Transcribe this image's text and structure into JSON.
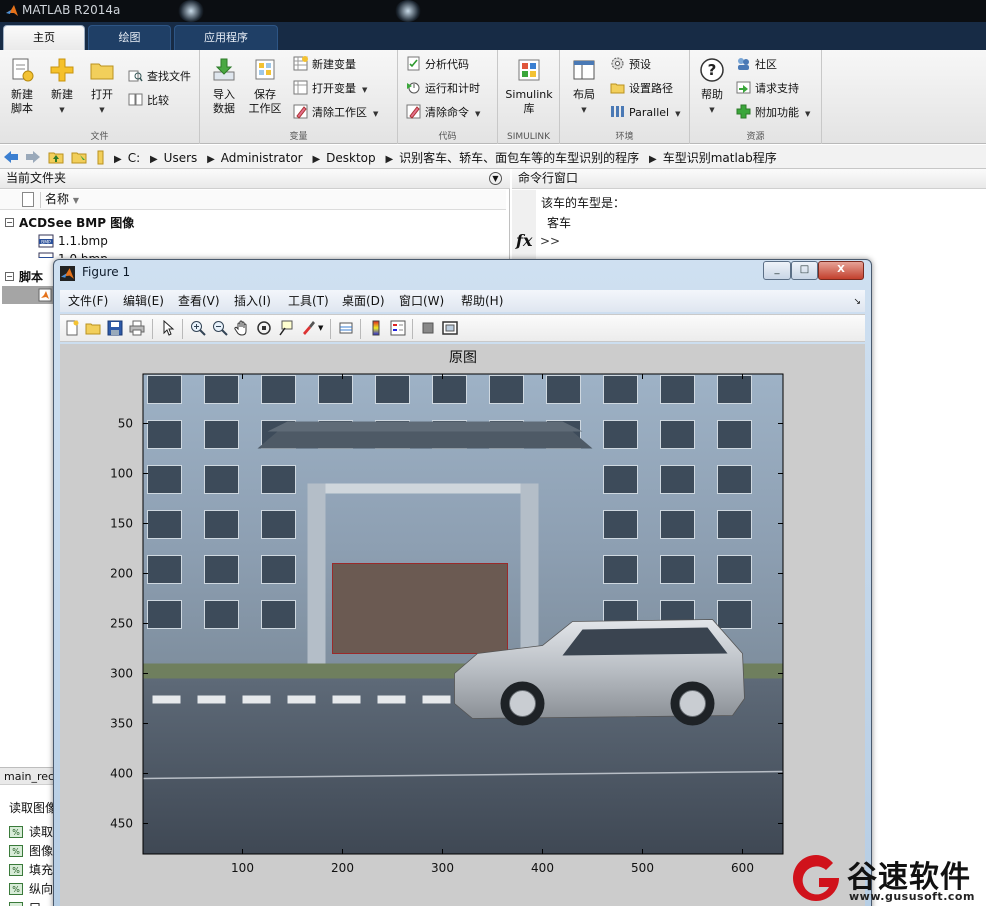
{
  "app": {
    "title": "MATLAB R2014a"
  },
  "ribbon": {
    "tabs": [
      {
        "label": "主页",
        "active": true
      },
      {
        "label": "绘图",
        "active": false
      },
      {
        "label": "应用程序",
        "active": false
      }
    ],
    "groups": {
      "file": {
        "label": "文件",
        "new_script": "新建\n脚本",
        "new": "新建",
        "open": "打开",
        "find_files": "查找文件",
        "compare": "比较"
      },
      "variable": {
        "label": "变量",
        "import_data": "导入\n数据",
        "save_workspace": "保存\n工作区",
        "new_variable": "新建变量",
        "open_variable": "打开变量",
        "clear_workspace": "清除工作区"
      },
      "code": {
        "label": "代码",
        "analyze_code": "分析代码",
        "run_and_time": "运行和计时",
        "clear_commands": "清除命令"
      },
      "simulink": {
        "label": "SIMULINK",
        "library": "Simulink\n库"
      },
      "environment": {
        "label": "环境",
        "layout": "布局",
        "preferences": "预设",
        "set_path": "设置路径",
        "parallel": "Parallel"
      },
      "resources": {
        "label": "资源",
        "help": "帮助",
        "community": "社区",
        "request_support": "请求支持",
        "add_ons": "附加功能"
      }
    }
  },
  "address": {
    "segments": [
      "C:",
      "Users",
      "Administrator",
      "Desktop",
      "识别客车、轿车、面包车等的车型识别的程序",
      "车型识别matlab程序"
    ]
  },
  "folder_panel": {
    "title": "当前文件夹",
    "column_name": "名称",
    "groups": [
      {
        "label": "ACDSee BMP 图像",
        "files": [
          "1.1.bmp",
          "1.0.bmp"
        ]
      },
      {
        "label": "脚本",
        "files": [
          ""
        ]
      }
    ],
    "details_header": "main_rec",
    "details_title": "读取图像",
    "details_items": [
      "读取",
      "图像",
      "填充",
      "纵向",
      "口"
    ]
  },
  "command_window": {
    "title": "命令行窗口",
    "line1": "该车的车型是：",
    "line2": "客车",
    "fx": "fx",
    "prompt": ">>"
  },
  "figure": {
    "title": "Figure 1",
    "menus": [
      "文件(F)",
      "编辑(E)",
      "查看(V)",
      "插入(I)",
      "工具(T)",
      "桌面(D)",
      "窗口(W)",
      "帮助(H)"
    ],
    "window_buttons": [
      "_",
      "□",
      "X"
    ]
  },
  "chart_data": {
    "type": "image",
    "title": "原图",
    "x_ticks": [
      100,
      200,
      300,
      400,
      500,
      600
    ],
    "y_ticks": [
      50,
      100,
      150,
      200,
      250,
      300,
      350,
      400,
      450
    ],
    "xlim": [
      0.5,
      640.5
    ],
    "ylim": [
      0.5,
      480.5
    ],
    "y_direction": "reverse",
    "image_description": "grey multi-storey building with Chinese-style gate, silver SUV on road"
  },
  "watermark": {
    "name": "谷速软件",
    "url": "www.gususoft.com"
  },
  "colors": {
    "ribbon_tab_bar": "#172b45",
    "titlebar": "#0b0e12",
    "figure_bg": "#cccccc",
    "watermark_red": "#d0121b"
  }
}
